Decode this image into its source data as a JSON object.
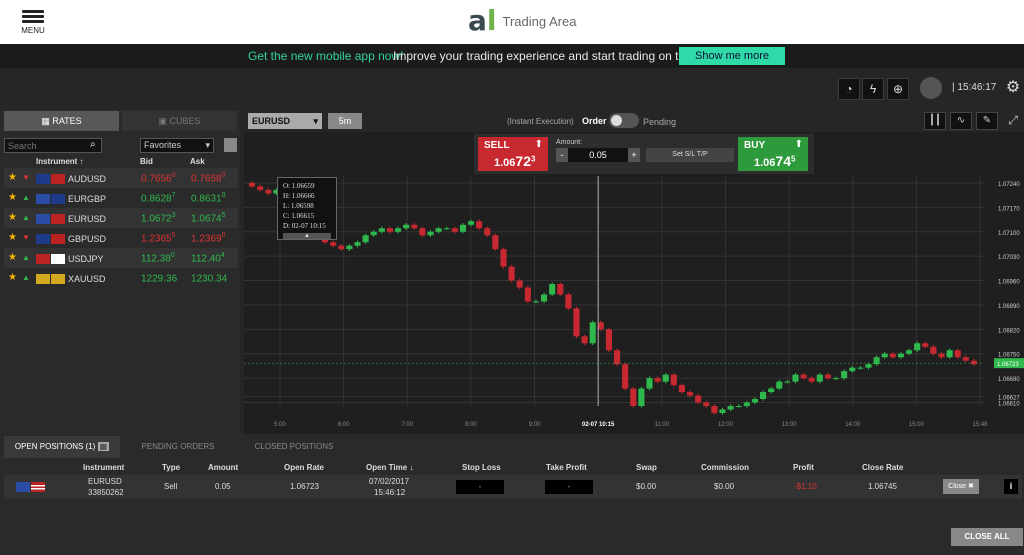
{
  "header": {
    "menu_label": "MENU",
    "brand_name": "Trading Area"
  },
  "promo": {
    "headline": "Get the new mobile app now!",
    "text": "Improve your trading experience and start trading on the go",
    "cta": "Show me more"
  },
  "toolbar": {
    "clock": "15:46:17"
  },
  "rates_panel": {
    "tabs": [
      "RATES",
      "CUBES"
    ],
    "search_placeholder": "Search",
    "filter_value": "Favorites",
    "columns": {
      "instrument": "Instrument ↑",
      "bid": "Bid",
      "ask": "Ask"
    },
    "rows": [
      {
        "symbol": "AUDUSD",
        "bid": "0.7656",
        "bid_sup": "0",
        "ask": "0.7658",
        "ask_sup": "0",
        "dir": "down",
        "color": "red"
      },
      {
        "symbol": "EURGBP",
        "bid": "0.8628",
        "bid_sup": "7",
        "ask": "0.8631",
        "ask_sup": "0",
        "dir": "up",
        "color": "green"
      },
      {
        "symbol": "EURUSD",
        "bid": "1.0672",
        "bid_sup": "3",
        "ask": "1.0674",
        "ask_sup": "5",
        "dir": "up",
        "color": "green"
      },
      {
        "symbol": "GBPUSD",
        "bid": "1.2365",
        "bid_sup": "5",
        "ask": "1.2369",
        "ask_sup": "0",
        "dir": "down",
        "color": "red"
      },
      {
        "symbol": "USDJPY",
        "bid": "112.38",
        "bid_sup": "0",
        "ask": "112.40",
        "ask_sup": "4",
        "dir": "up",
        "color": "green"
      },
      {
        "symbol": "XAUUSD",
        "bid": "1229.36",
        "bid_sup": "",
        "ask": "1230.34",
        "ask_sup": "",
        "dir": "up",
        "color": "green"
      }
    ]
  },
  "chart_panel": {
    "instrument": "EURUSD",
    "timeframe": "5m",
    "execution_label": "(Instant Execution)",
    "order_label": "Order",
    "pending_label": "Pending",
    "sell": {
      "label": "SELL",
      "price_main": "1.06",
      "price_big": "72",
      "price_sup": "3"
    },
    "buy": {
      "label": "BUY",
      "price_main": "1.06",
      "price_big": "74",
      "price_sup": "5"
    },
    "amount_label": "Amount:",
    "amount_value": "0.05",
    "minus": "-",
    "plus": "+",
    "sltp_label": "Set S/L T/P",
    "tooltip": {
      "o": "O:   1.06659",
      "h": "H:   1.06666",
      "l": "L:   1.06598",
      "c": "C:   1.06615",
      "d": "D:   02-07 10:15"
    }
  },
  "chart_data": {
    "type": "candlestick",
    "x_ticks": [
      "5:00",
      "6:00",
      "7:00",
      "8:00",
      "9:00",
      "02-07 10:15",
      "11:00",
      "12:00",
      "13:00",
      "14:00",
      "15:00",
      "15:48"
    ],
    "y_ticks": [
      "1.07240",
      "1.07170",
      "1.07100",
      "1.07030",
      "1.06960",
      "1.06890",
      "1.06820",
      "1.06750",
      "1.06680",
      "1.06627",
      "1.06610"
    ],
    "ylim": [
      1.066,
      1.0726
    ],
    "current_price": "1.06723",
    "crosshair_x": "02-07 10:15",
    "close_series": [
      1.0723,
      1.0722,
      1.0721,
      1.0722,
      1.0719,
      1.0716,
      1.0714,
      1.0712,
      1.071,
      1.0707,
      1.0706,
      1.0705,
      1.0706,
      1.0707,
      1.0709,
      1.071,
      1.0711,
      1.071,
      1.0711,
      1.0712,
      1.0711,
      1.0709,
      1.071,
      1.0711,
      1.0711,
      1.071,
      1.0712,
      1.0713,
      1.0711,
      1.0709,
      1.0705,
      1.07,
      1.0696,
      1.0694,
      1.069,
      1.069,
      1.0692,
      1.0695,
      1.0692,
      1.0688,
      1.068,
      1.0678,
      1.0684,
      1.0682,
      1.0676,
      1.0672,
      1.0665,
      1.066,
      1.0665,
      1.0668,
      1.0667,
      1.0669,
      1.0666,
      1.0664,
      1.0663,
      1.0661,
      1.066,
      1.0658,
      1.0659,
      1.066,
      1.066,
      1.0661,
      1.0662,
      1.0664,
      1.0665,
      1.0667,
      1.0667,
      1.0669,
      1.0668,
      1.0667,
      1.0669,
      1.0668,
      1.0668,
      1.067,
      1.0671,
      1.0671,
      1.0672,
      1.0674,
      1.0675,
      1.0674,
      1.0675,
      1.0676,
      1.0678,
      1.0677,
      1.0675,
      1.0674,
      1.0676,
      1.0674,
      1.0673,
      1.0672
    ]
  },
  "positions": {
    "tabs": [
      "OPEN POSITIONS (1)",
      "PENDING ORDERS",
      "CLOSED POSITIONS"
    ],
    "columns": [
      "Instrument",
      "Type",
      "Amount",
      "Open Rate",
      "Open Time ↓",
      "Stop Loss",
      "Take Profit",
      "Swap",
      "Commission",
      "Profit",
      "Close Rate"
    ],
    "row": {
      "instrument": "EURUSD",
      "id": "33850262",
      "type": "Sell",
      "amount": "0.05",
      "open_rate": "1.06723",
      "open_date": "07/02/2017",
      "open_time": "15:46:12",
      "stop_loss": "-",
      "take_profit": "-",
      "swap": "$0.00",
      "commission": "$0.00",
      "profit": "-$1.10",
      "close_rate": "1.06745"
    },
    "close_label": "Close ✖",
    "info_label": "i",
    "close_all": "CLOSE ALL"
  }
}
